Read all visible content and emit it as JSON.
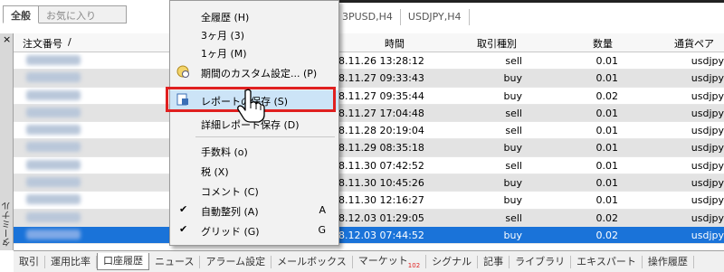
{
  "top": {
    "fav_tabs": [
      {
        "label": "全般"
      },
      {
        "label": "お気に入り"
      }
    ],
    "chart_tabs": [
      "3PUSD,H4",
      "USDJPY,H4"
    ]
  },
  "side": {
    "close": "×",
    "label": "ターミナル"
  },
  "table": {
    "headers": {
      "order": "注文番号",
      "sort_indicator": "/",
      "time": "時間",
      "type": "取引種別",
      "qty": "数量",
      "symbol": "通貨ペア"
    },
    "rows": [
      {
        "time": "8.11.26 13:28:12",
        "type": "sell",
        "qty": "0.01",
        "symbol": "usdjpy"
      },
      {
        "time": "8.11.27 09:33:43",
        "type": "buy",
        "qty": "0.01",
        "symbol": "usdjpy"
      },
      {
        "time": "8.11.27 09:35:44",
        "type": "buy",
        "qty": "0.02",
        "symbol": "usdjpy"
      },
      {
        "time": "8.11.27 17:04:48",
        "type": "sell",
        "qty": "0.01",
        "symbol": "usdjpy"
      },
      {
        "time": "8.11.28 20:19:04",
        "type": "sell",
        "qty": "0.01",
        "symbol": "usdjpy"
      },
      {
        "time": "8.11.29 08:35:18",
        "type": "buy",
        "qty": "0.01",
        "symbol": "usdjpy"
      },
      {
        "time": "8.11.30 07:42:52",
        "type": "sell",
        "qty": "0.01",
        "symbol": "usdjpy"
      },
      {
        "time": "8.11.30 10:45:26",
        "type": "buy",
        "qty": "0.01",
        "symbol": "usdjpy"
      },
      {
        "time": "8.11.30 12:16:27",
        "type": "buy",
        "qty": "0.01",
        "symbol": "usdjpy"
      },
      {
        "time": "8.12.03 01:29:05",
        "type": "sell",
        "qty": "0.02",
        "symbol": "usdjpy"
      },
      {
        "time": "8.12.03 07:44:52",
        "type": "buy",
        "qty": "0.02",
        "symbol": "usdjpy"
      }
    ]
  },
  "menu": {
    "all_history": "全履歴 (H)",
    "three_months": "3ヶ月 (3)",
    "one_month": "1ヶ月 (M)",
    "custom_period": "期間のカスタム設定... (P)",
    "save_report": "レポートの保存 (S)",
    "save_detail_report": "詳細レポート保存 (D)",
    "commission": "手数料 (o)",
    "tax": "税 (X)",
    "comment": "コメント (C)",
    "auto_arrange": "自動整列 (A)",
    "auto_arrange_shortcut": "A",
    "grid": "グリッド (G)",
    "grid_shortcut": "G",
    "check_mark": "✔"
  },
  "bottom_tabs": [
    {
      "label": "取引"
    },
    {
      "label": "運用比率"
    },
    {
      "label": "口座履歴",
      "active": true
    },
    {
      "label": "ニュース"
    },
    {
      "label": "アラーム設定"
    },
    {
      "label": "メールボックス"
    },
    {
      "label": "マーケット",
      "badge": "102"
    },
    {
      "label": "シグナル"
    },
    {
      "label": "記事"
    },
    {
      "label": "ライブラリ"
    },
    {
      "label": "エキスパート"
    },
    {
      "label": "操作履歴"
    }
  ],
  "colors": {
    "selection": "#1a73d9",
    "highlight_box": "#e02020",
    "menu_hover": "#cce4f7"
  }
}
